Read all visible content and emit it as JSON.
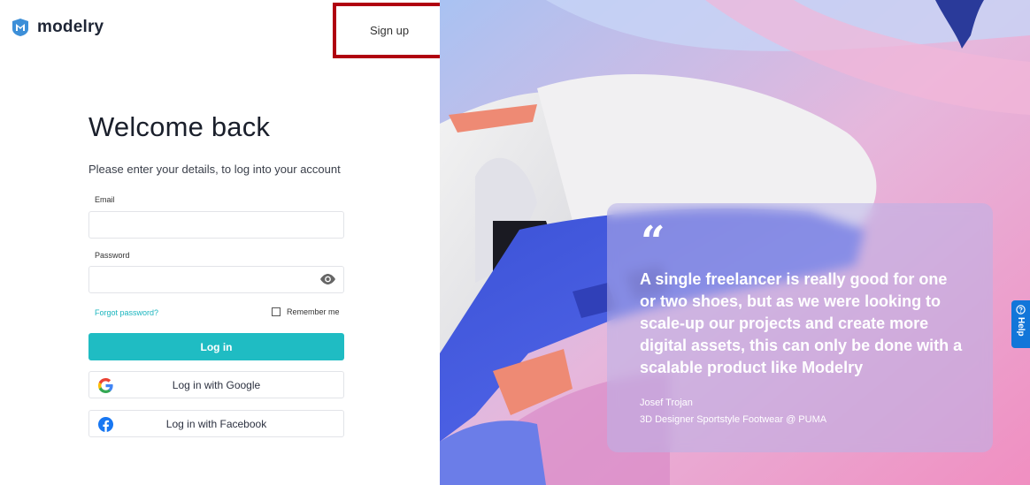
{
  "brand": {
    "name": "modelry",
    "logo_icon": "shield-m-icon",
    "accent_color": "#1fbcc3",
    "logo_color": "#3d8fd8"
  },
  "header": {
    "signup_label": "Sign up",
    "highlight_color": "#b00010"
  },
  "login": {
    "title": "Welcome back",
    "subtitle": "Please enter your details, to log into your account",
    "email_label": "Email",
    "email_value": "",
    "password_label": "Password",
    "password_value": "",
    "forgot_label": "Forgot password?",
    "remember_label": "Remember me",
    "login_button": "Log in",
    "google_button": "Log in with Google",
    "facebook_button": "Log in with Facebook"
  },
  "testimonial": {
    "quote_mark": "“",
    "text": "A single freelancer is really good for one or two shoes, but as we were looking to scale-up our projects and create more digital assets, this can only be done with a scalable product like Modelry",
    "author": "Josef Trojan",
    "role": "3D Designer Sportstyle Footwear @ PUMA"
  },
  "help_tab": {
    "label": "Help",
    "color": "#1276d9"
  }
}
